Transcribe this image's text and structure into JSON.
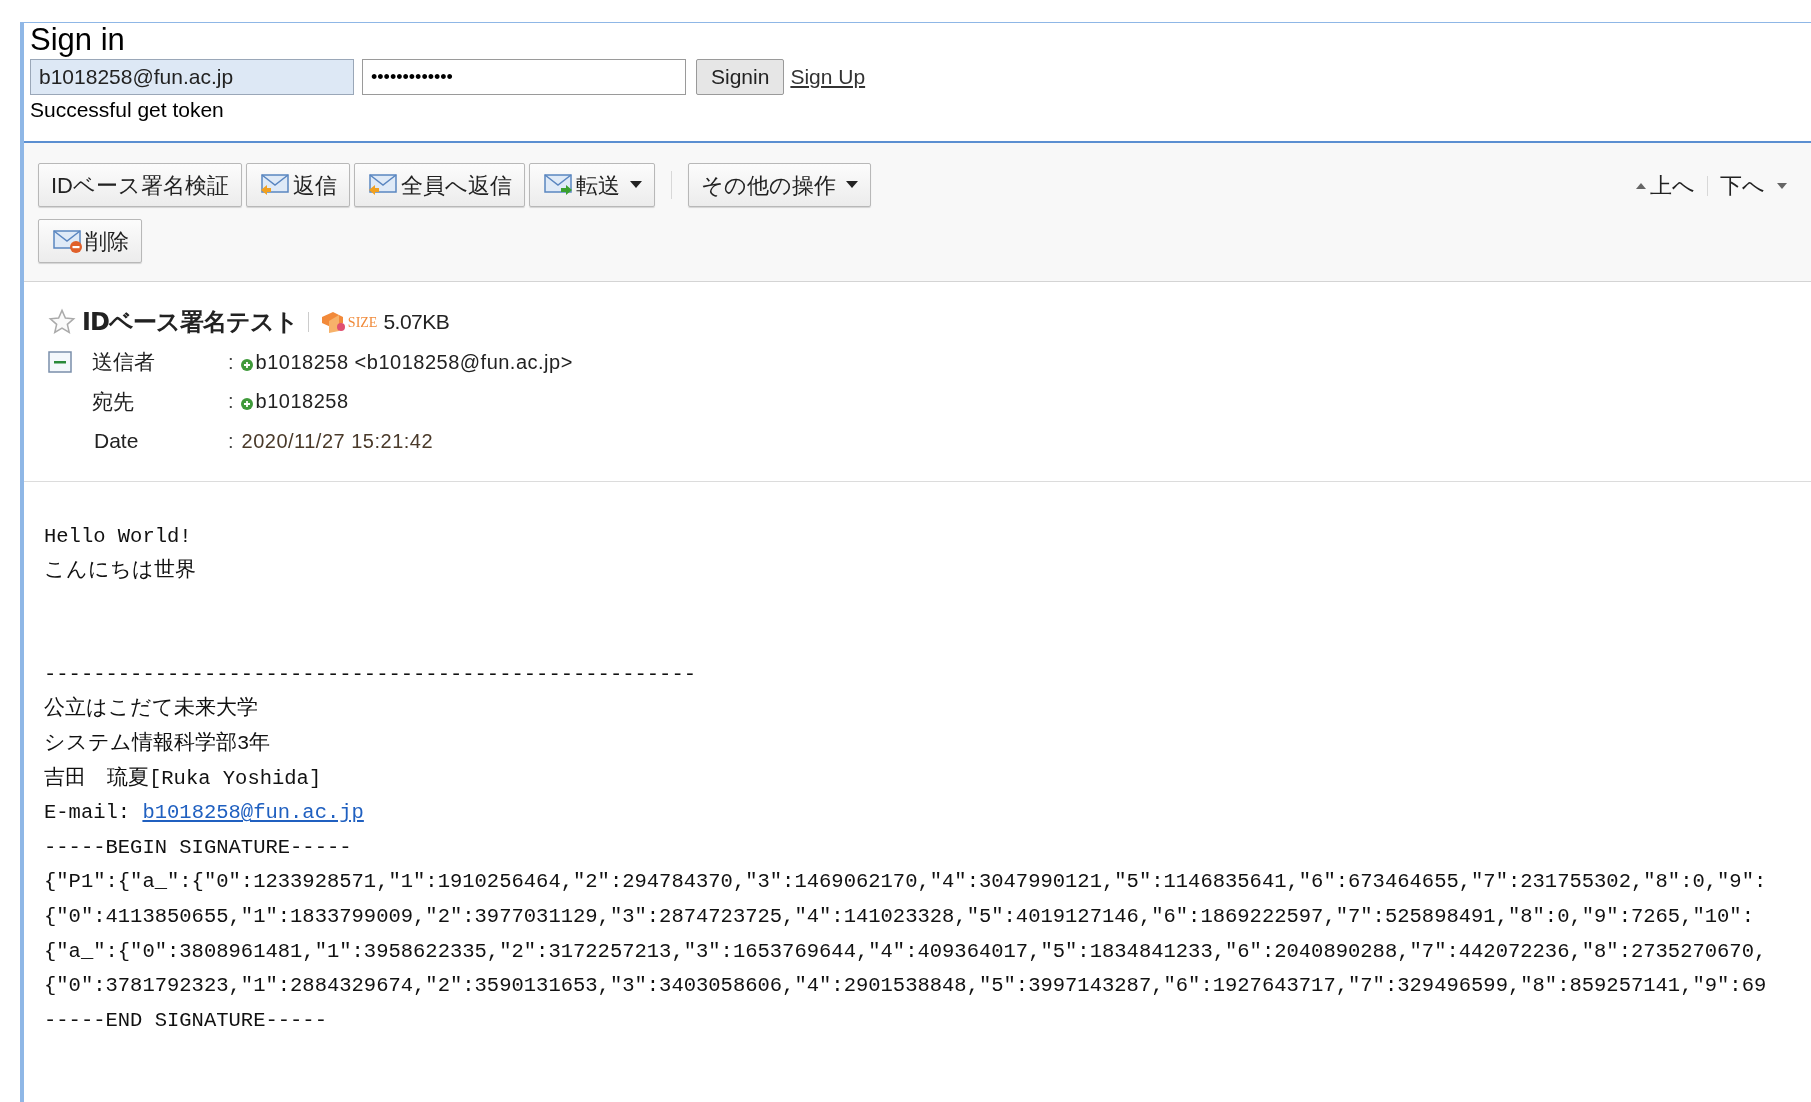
{
  "signin": {
    "title": "Sign in",
    "email": "b1018258@fun.ac.jp",
    "password": "•••••••••••••",
    "button": "Signin",
    "link": "Sign Up",
    "status": "Successful get token"
  },
  "toolbar": {
    "buttons": [
      {
        "label": "IDベース署名検証",
        "kind": "plain",
        "dropdown": false
      },
      {
        "label": "返信",
        "kind": "reply",
        "dropdown": false
      },
      {
        "label": "全員へ返信",
        "kind": "reply",
        "dropdown": false
      },
      {
        "label": "転送",
        "kind": "forward",
        "dropdown": true
      },
      {
        "label": "その他の操作",
        "kind": "plain",
        "dropdown": true
      },
      {
        "label": "削除",
        "kind": "delete",
        "dropdown": false
      }
    ],
    "nav": [
      {
        "label": "上へ",
        "kind": "up"
      },
      {
        "label": "下へ",
        "kind": "down"
      }
    ]
  },
  "message": {
    "subject": "IDベース署名テスト",
    "starred": false,
    "size_label": "SIZE",
    "size": "5.07KB",
    "expanded": true,
    "headers": [
      {
        "label": "送信者",
        "separator": ":",
        "value": "b1018258 <b1018258@fun.ac.jp>",
        "contact": true
      },
      {
        "label": "宛先",
        "separator": ":",
        "value": "b1018258",
        "contact": true
      },
      {
        "label": "Date",
        "separator": ":",
        "value": "2020/11/27 15:21:42",
        "contact": false
      }
    ],
    "body": [
      {
        "text": "Hello World!"
      },
      {
        "text": "こんにちは世界"
      },
      {
        "kind": "divider",
        "text": "-----------------------------------------------------"
      },
      {
        "text": "公立はこだて未来大学"
      },
      {
        "text": "システム情報科学部3年"
      },
      {
        "text": "吉田　琉夏[Ruka Yoshida]"
      },
      {
        "text": "E-mail: ",
        "link": "b1018258@fun.ac.jp"
      },
      {
        "text": "-----BEGIN SIGNATURE-----"
      },
      {
        "text": "{\"P1\":{\"a_\":{\"0\":1233928571,\"1\":1910256464,\"2\":294784370,\"3\":1469062170,\"4\":3047990121,\"5\":1146835641,\"6\":673464655,\"7\":231755302,\"8\":0,\"9\":"
      },
      {
        "text": "{\"0\":4113850655,\"1\":1833799009,\"2\":3977031129,\"3\":2874723725,\"4\":141023328,\"5\":4019127146,\"6\":1869222597,\"7\":525898491,\"8\":0,\"9\":7265,\"10\":"
      },
      {
        "text": "{\"a_\":{\"0\":3808961481,\"1\":3958622335,\"2\":3172257213,\"3\":1653769644,\"4\":409364017,\"5\":1834841233,\"6\":2040890288,\"7\":442072236,\"8\":2735270670,"
      },
      {
        "text": "{\"0\":3781792323,\"1\":2884329674,\"2\":3590131653,\"3\":3403058606,\"4\":2901538848,\"5\":3997143287,\"6\":1927643717,\"7\":329496599,\"8\":859257141,\"9\":69"
      },
      {
        "text": "-----END SIGNATURE-----"
      }
    ]
  }
}
